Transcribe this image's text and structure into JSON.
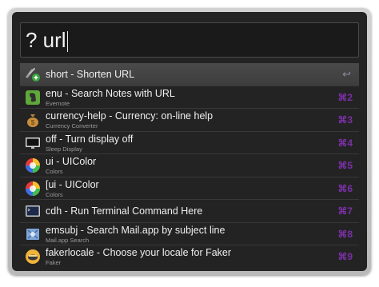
{
  "search": {
    "query": "? url"
  },
  "results": [
    {
      "title": "short - Shorten URL",
      "subtitle": "",
      "shortcut": "",
      "enter": "↩",
      "icon": "link-shortener-icon"
    },
    {
      "title": "enu - Search Notes with URL",
      "subtitle": "Evernote",
      "shortcut": "⌘2",
      "icon": "evernote-icon"
    },
    {
      "title": "currency-help - Currency: on-line help",
      "subtitle": "Currency Converter",
      "shortcut": "⌘3",
      "icon": "money-bag-icon"
    },
    {
      "title": "off - Turn display off",
      "subtitle": "Sleep Display",
      "shortcut": "⌘4",
      "icon": "monitor-icon"
    },
    {
      "title": "ui - UIColor",
      "subtitle": "Colors",
      "shortcut": "⌘5",
      "icon": "color-wheel-icon"
    },
    {
      "title": "[ui - UIColor",
      "subtitle": "Colors",
      "shortcut": "⌘6",
      "icon": "color-wheel-icon"
    },
    {
      "title": "cdh - Run Terminal Command Here",
      "subtitle": "",
      "shortcut": "⌘7",
      "icon": "terminal-icon"
    },
    {
      "title": "emsubj - Search Mail.app by subject line",
      "subtitle": "Mail.app Search",
      "shortcut": "⌘8",
      "icon": "mail-icon"
    },
    {
      "title": "fakerlocale - Choose your locale for Faker",
      "subtitle": "Faker",
      "shortcut": "⌘9",
      "icon": "faker-icon"
    }
  ]
}
